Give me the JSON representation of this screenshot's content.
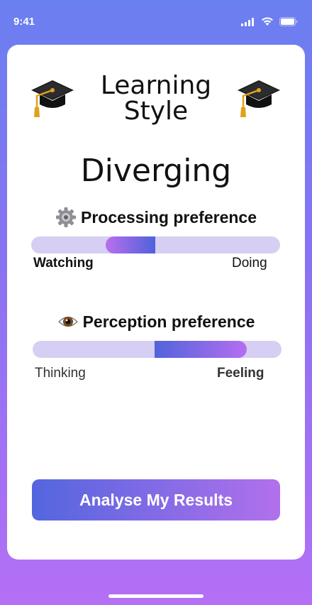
{
  "status": {
    "time": "9:41"
  },
  "header": {
    "title_line1": "Learning",
    "title_line2": "Style",
    "icon": "graduation-cap-icon"
  },
  "result": {
    "style_name": "Diverging"
  },
  "processing": {
    "heading": "Processing preference",
    "icon": "gear-icon",
    "left_label": "Watching",
    "right_label": "Doing",
    "fill_from": 0.3,
    "fill_to": 0.5
  },
  "perception": {
    "heading": "Perception preference",
    "icon": "eye-icon",
    "left_label": "Thinking",
    "right_label": "Feeling",
    "fill_from": 0.49,
    "fill_to": 0.86
  },
  "cta": {
    "label": "Analyse My Results"
  },
  "colors": {
    "bar_track": "#d6cff3",
    "gradient_blue": "#5366de",
    "gradient_purple": "#b270ec"
  }
}
